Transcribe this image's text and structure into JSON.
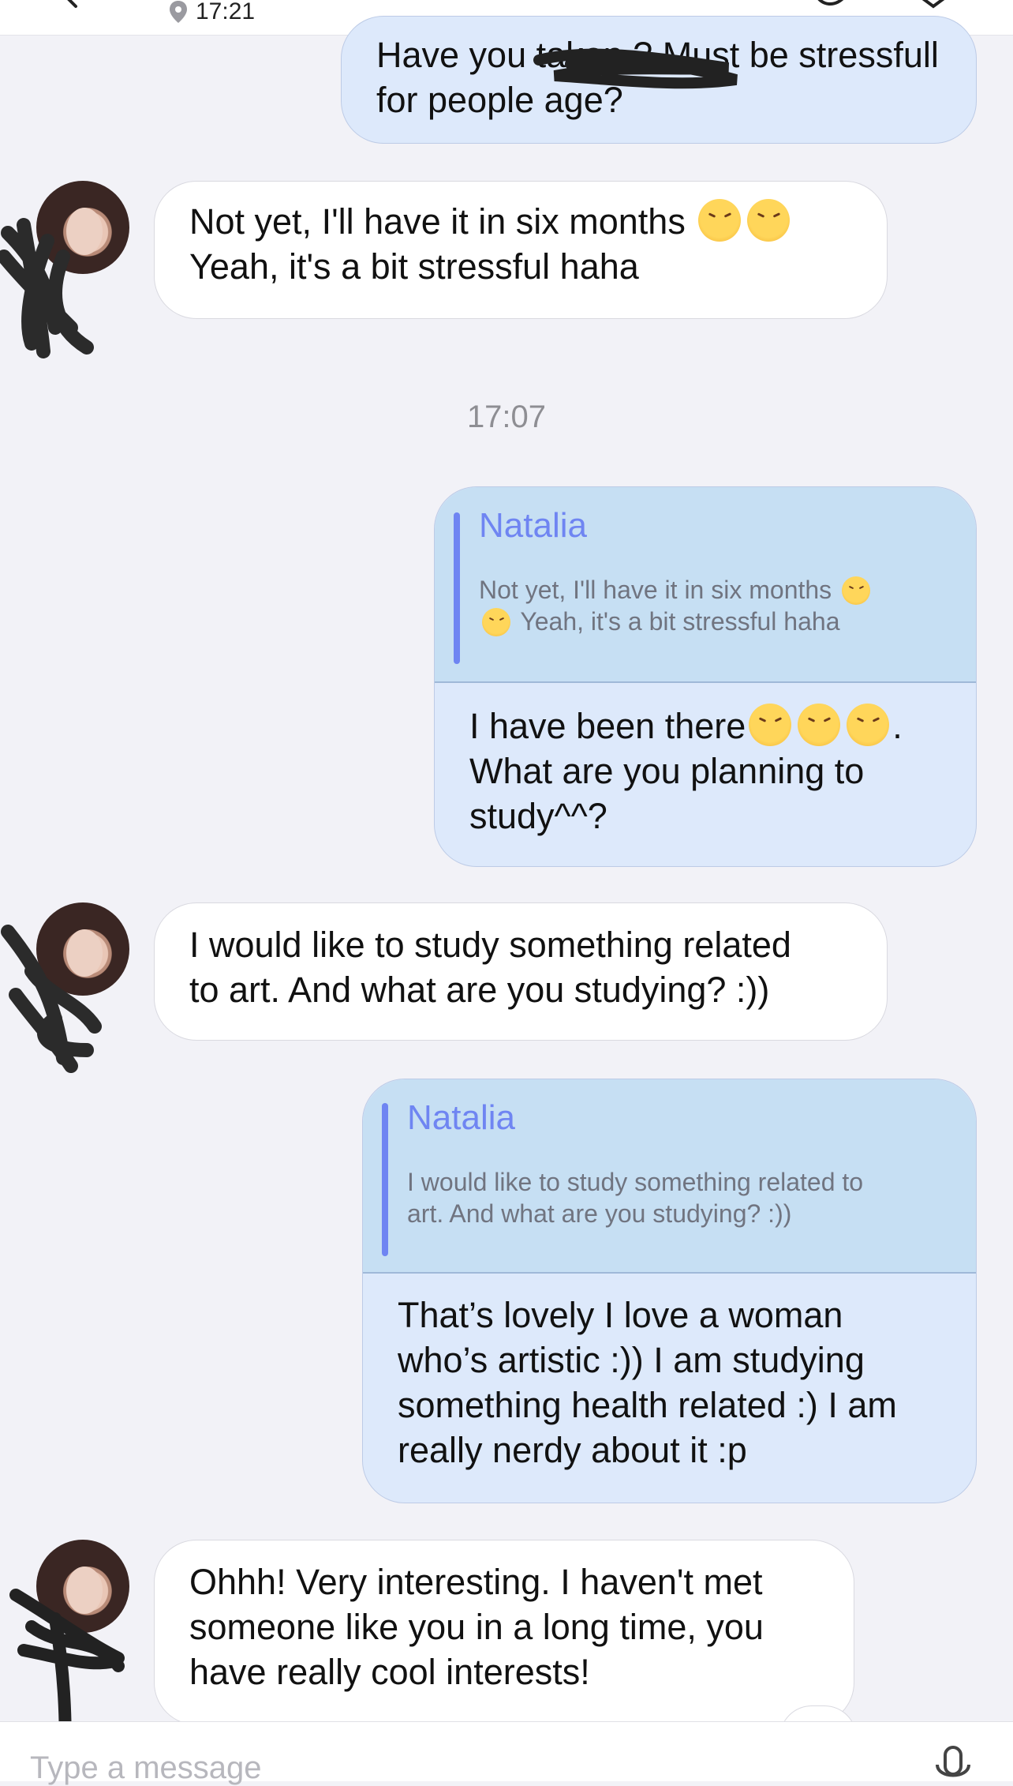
{
  "status": {
    "time": "17:21"
  },
  "messages": {
    "m1_out": {
      "text": "Have you taken  ? Must be stressfull for people  age?"
    },
    "m2_in": {
      "line1": "Not yet, I'll have it in six months",
      "line2": "Yeah, it's a bit stressful haha"
    },
    "timestamp": "17:07",
    "m3_out": {
      "quote_name": "Natalia",
      "quote_line1": "Not yet, I'll have it in six months",
      "quote_line2": "Yeah, it's a bit stressful haha",
      "line1": "I have been there",
      "line1_end": ".",
      "line2": "What are you planning to",
      "line3": "study^^?"
    },
    "m4_in": {
      "line1": "I would like to study something related",
      "line2": "to art. And what are you studying? :))"
    },
    "m5_out": {
      "quote_name": "Natalia",
      "quote_line1": "I would like to study something related to",
      "quote_line2": "art. And what are you studying? :))",
      "line1": "That’s lovely I love a woman",
      "line2": "who’s artistic :)) I am studying",
      "line3": "something health related :) I am",
      "line4": "really nerdy about it :p"
    },
    "m6_in": {
      "line1": "Ohhh! Very interesting. I haven't met",
      "line2": "someone like you in a long time, you",
      "line3": "have really cool interests!"
    }
  },
  "composer": {
    "placeholder": "Type a message"
  },
  "icons": [
    "location-pin-icon",
    "microphone-icon",
    "emoji-icon"
  ],
  "colors": {
    "accent": "#6f85f2",
    "outgoing_bubble": "#dde9fb",
    "incoming_bubble": "#ffffff",
    "background": "#f2f2f7"
  }
}
